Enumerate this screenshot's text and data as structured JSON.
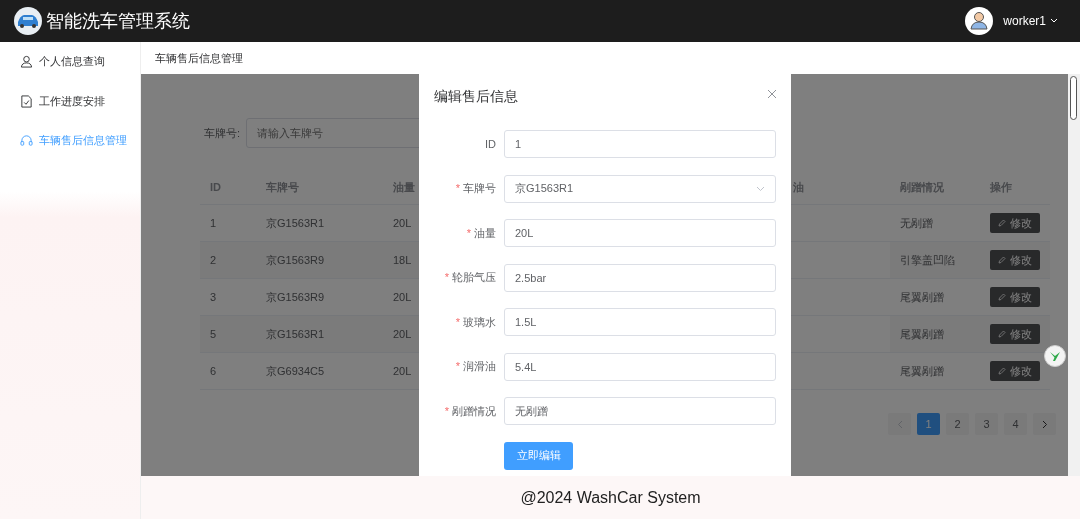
{
  "header": {
    "title": "智能洗车管理系统",
    "user": "worker1"
  },
  "sidebar": {
    "items": [
      {
        "label": "个人信息查询",
        "kind": "person",
        "selected": false
      },
      {
        "label": "工作进度安排",
        "kind": "document",
        "selected": false
      },
      {
        "label": "车辆售后信息管理",
        "kind": "headset",
        "selected": true
      }
    ]
  },
  "breadcrumb": "车辆售后信息管理",
  "search": {
    "label": "车牌号:",
    "placeholder": "请输入车牌号"
  },
  "table": {
    "columns": [
      "ID",
      "车牌号",
      "油量",
      "油",
      "剐蹭情况",
      "操作"
    ],
    "rows": [
      {
        "id": "1",
        "plate": "京G1563R1",
        "oil": "20L",
        "scratch": "无剐蹭",
        "action": "修改"
      },
      {
        "id": "2",
        "plate": "京G1563R9",
        "oil": "18L",
        "scratch": "引擎盖凹陷",
        "action": "修改"
      },
      {
        "id": "3",
        "plate": "京G1563R9",
        "oil": "20L",
        "scratch": "尾翼剐蹭",
        "action": "修改"
      },
      {
        "id": "5",
        "plate": "京G1563R1",
        "oil": "20L",
        "scratch": "尾翼剐蹭",
        "action": "修改"
      },
      {
        "id": "6",
        "plate": "京G6934C5",
        "oil": "20L",
        "scratch": "尾翼剐蹭",
        "action": "修改"
      }
    ]
  },
  "pagination": {
    "prev_disabled": true,
    "pages": [
      {
        "label": "1",
        "selected": true
      },
      {
        "label": "2",
        "selected": false
      },
      {
        "label": "3",
        "selected": false
      },
      {
        "label": "4",
        "selected": false
      }
    ]
  },
  "dialog": {
    "title": "编辑售后信息",
    "fields": [
      {
        "label": "ID",
        "kind": "input",
        "value": "1"
      },
      {
        "label": "车牌号",
        "kind": "select",
        "mark": "*",
        "value": "京G1563R1"
      },
      {
        "label": "油量",
        "kind": "input",
        "mark": "*",
        "value": "20L"
      },
      {
        "label": "轮胎气压",
        "kind": "input",
        "mark": "*",
        "value": "2.5bar"
      },
      {
        "label": "玻璃水",
        "kind": "input",
        "mark": "*",
        "value": "1.5L"
      },
      {
        "label": "润滑油",
        "kind": "input",
        "mark": "*",
        "value": "5.4L"
      },
      {
        "label": "剐蹭情况",
        "kind": "input",
        "mark": "*",
        "value": "无剐蹭"
      }
    ],
    "submit": "立即编辑"
  },
  "footer": "@2024 WashCar System"
}
